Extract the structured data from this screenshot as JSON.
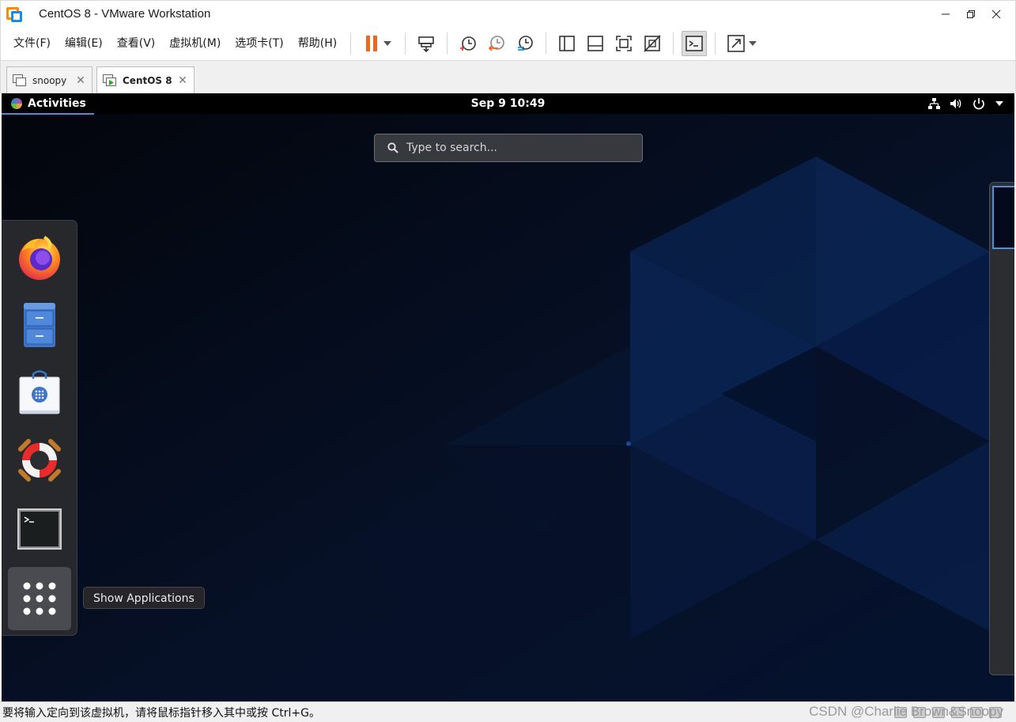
{
  "window": {
    "title": "CentOS 8 - VMware Workstation"
  },
  "menu": [
    {
      "label": "文件(F)"
    },
    {
      "label": "编辑(E)"
    },
    {
      "label": "查看(V)"
    },
    {
      "label": "虚拟机(M)"
    },
    {
      "label": "选项卡(T)"
    },
    {
      "label": "帮助(H)"
    }
  ],
  "tabs": [
    {
      "label": "snoopy",
      "active": false
    },
    {
      "label": "CentOS 8",
      "active": true
    }
  ],
  "guest": {
    "activities": "Activities",
    "clock": "Sep 9  10:49",
    "search_placeholder": "Type to search...",
    "tooltip": "Show Applications",
    "dash_apps": [
      "firefox-icon",
      "files-icon",
      "software-icon",
      "help-icon",
      "terminal-icon",
      "show-apps-icon"
    ]
  },
  "status": {
    "message": "要将输入定向到该虚拟机，请将鼠标指针移入其中或按 Ctrl+G。",
    "watermark": "CSDN @Charlie Brown&Snoopy"
  },
  "colors": {
    "accent": "#4a90d9",
    "pause": "#f0651f",
    "wallpaper": "#06080f"
  }
}
